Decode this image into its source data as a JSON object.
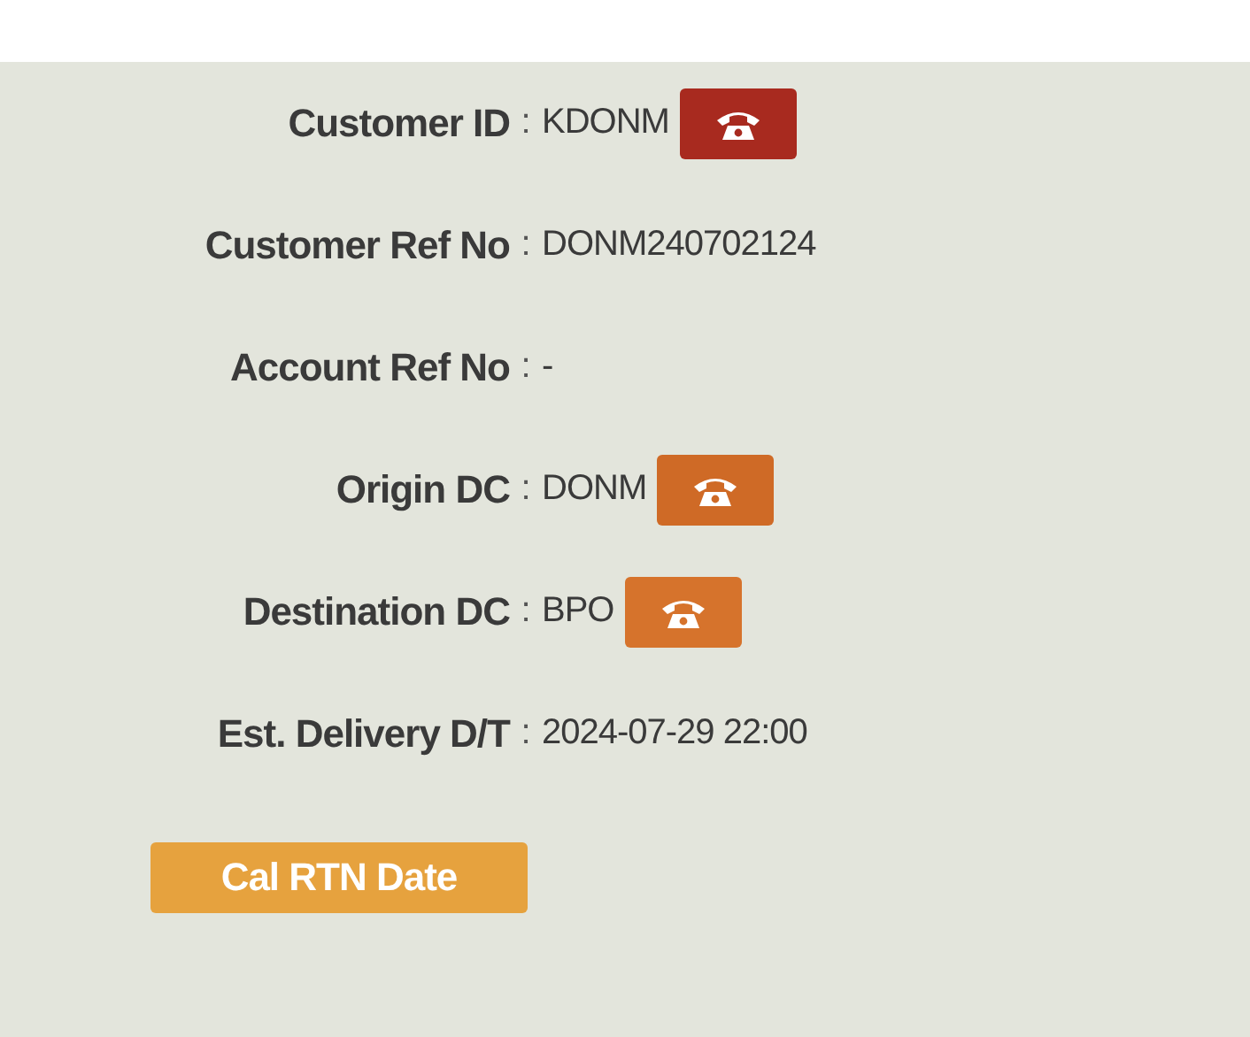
{
  "fields": [
    {
      "label": "Customer ID",
      "separator": ":",
      "value": "KDONM",
      "phone_button": {
        "color": "#a82a1f"
      }
    },
    {
      "label": "Customer Ref No",
      "separator": ":",
      "value": "DONM240702124"
    },
    {
      "label": "Account Ref No",
      "separator": ":",
      "value": "-"
    },
    {
      "label": "Origin DC",
      "separator": ":",
      "value": "DONM",
      "phone_button": {
        "color": "#cf6a26"
      }
    },
    {
      "label": "Destination DC",
      "separator": ":",
      "value": "BPO",
      "phone_button": {
        "color": "#d6732c"
      }
    },
    {
      "label": "Est. Delivery D/T",
      "separator": ":",
      "value": "2024-07-29 22:00"
    }
  ],
  "action_button": {
    "label": "Cal RTN Date"
  }
}
